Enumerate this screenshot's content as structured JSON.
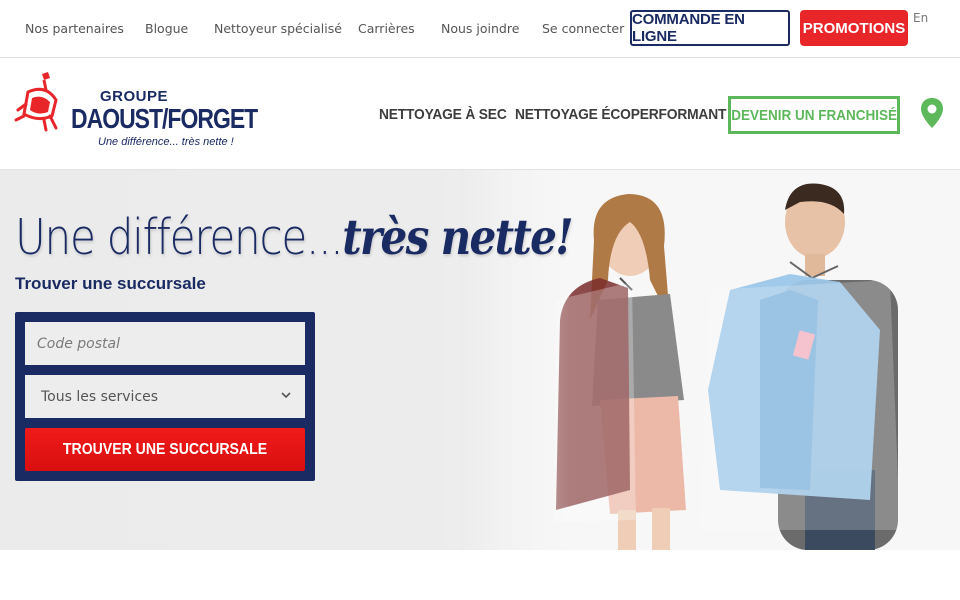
{
  "topbar": {
    "links": [
      "Nos partenaires",
      "Blogue",
      "Nettoyeur spécialisé",
      "Carrières",
      "Nous joindre",
      "Se connecter"
    ],
    "commande_label": "COMMANDE EN LIGNE",
    "promo_label": "PROMOTIONS",
    "lang_label": "En"
  },
  "logo": {
    "groupe": "GROUPE",
    "name": "DAOUST/FORGET",
    "tagline": "Une différence... très nette !"
  },
  "mainnav": {
    "items": [
      "NETTOYAGE À SEC",
      "NETTOYAGE ÉCOPERFORMANT"
    ],
    "franchise_label": "DEVENIR UN FRANCHISÉ",
    "location_icon": "map-pin-icon"
  },
  "hero": {
    "title_plain": "Une différence...",
    "title_script": "très nette!",
    "subtitle": "Trouver une succursale",
    "postal_placeholder": "Code postal",
    "services_selected": "Tous les services",
    "search_button": "TROUVER UNE SUCCURSALE"
  },
  "colors": {
    "navy": "#1a2b63",
    "red": "#e8262a",
    "green": "#5db85c"
  }
}
